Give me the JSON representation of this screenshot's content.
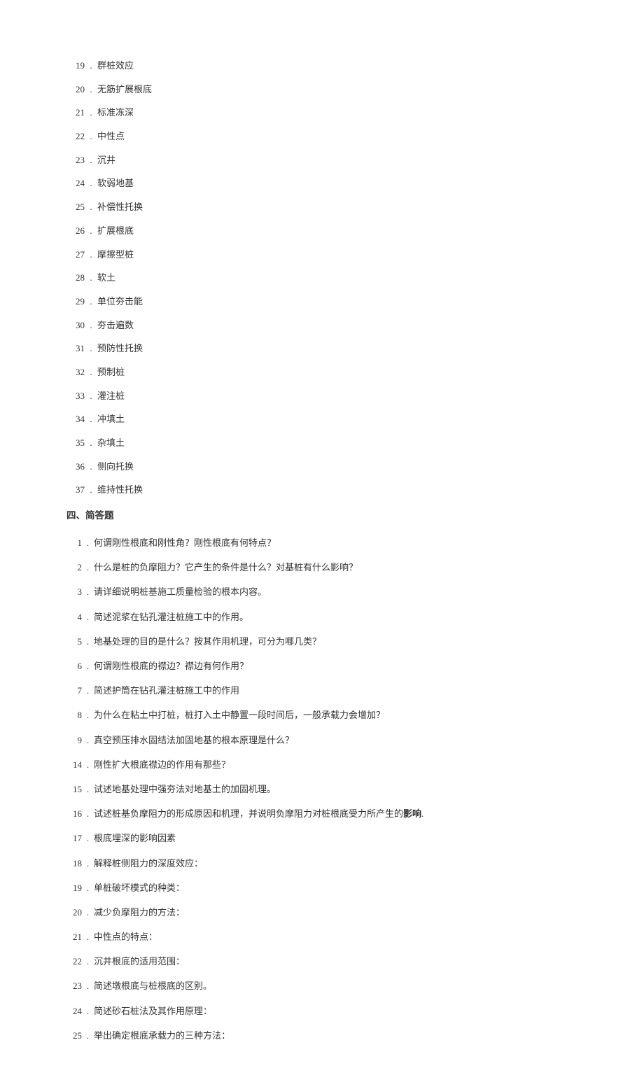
{
  "section_a_items": [
    {
      "num": "19",
      "text": "群桩效应"
    },
    {
      "num": "20",
      "text": "无筋扩展根底"
    },
    {
      "num": "21",
      "text": "标准冻深"
    },
    {
      "num": "22",
      "text": "中性点"
    },
    {
      "num": "23",
      "text": "沉井"
    },
    {
      "num": "24",
      "text": "软弱地基"
    },
    {
      "num": "25",
      "text": "补偿性托换"
    },
    {
      "num": "26",
      "text": "扩展根底"
    },
    {
      "num": "27",
      "text": "摩擦型桩"
    },
    {
      "num": "28",
      "text": "软土"
    },
    {
      "num": "29",
      "text": "单位夯击能"
    },
    {
      "num": "30",
      "text": "夯击遍数"
    },
    {
      "num": "31",
      "text": "预防性托换"
    },
    {
      "num": "32",
      "text": "预制桩"
    },
    {
      "num": "33",
      "text": "灌注桩"
    },
    {
      "num": "34",
      "text": "冲填土"
    },
    {
      "num": "35",
      "text": "杂填土"
    },
    {
      "num": "36",
      "text": "侧向托换"
    },
    {
      "num": "37",
      "text": "维持性托换"
    }
  ],
  "section_b_heading": "四、简答题",
  "section_b_items": [
    {
      "num": "1",
      "text": "何谓刚性根底和刚性角？刚性根底有何特点？"
    },
    {
      "num": "2",
      "text": "什么是桩的负摩阻力？它产生的条件是什么？对基桩有什么影响？"
    },
    {
      "num": "3",
      "text": "请详细说明桩基施工质量检验的根本内容。"
    },
    {
      "num": "4",
      "text": "简述泥浆在钻孔灌注桩施工中的作用。"
    },
    {
      "num": "5",
      "text": "地基处理的目的是什么？按其作用机理，可分为哪几类？"
    },
    {
      "num": "6",
      "text": "何谓刚性根底的襟边？襟边有何作用？"
    },
    {
      "num": "7",
      "text": "简述护筒在钻孔灌注桩施工中的作用"
    },
    {
      "num": "8",
      "text": "为什么在粘土中打桩，桩打入土中静置一段时间后，一般承载力会增加？"
    },
    {
      "num": "9",
      "text": "真空预压排水固结法加固地基的根本原理是什么？"
    },
    {
      "num": "14",
      "text": "刚性扩大根底襟边的作用有那些？"
    },
    {
      "num": "15",
      "text": "试述地基处理中强夯法对地基土的加固机理。"
    },
    {
      "num": "16",
      "text_prefix": "试述桩基负摩阻力的形成原因和机理，并说明负摩阻力对桩根底受力所产生的",
      "text_bold": "影响",
      "text_suffix": "."
    },
    {
      "num": "17",
      "text": "根底埋深的影响因素"
    },
    {
      "num": "18",
      "text": "解释桩侧阻力的深度效应："
    },
    {
      "num": "19",
      "text": "单桩破坏模式的种类："
    },
    {
      "num": "20",
      "text": "减少负摩阻力的方法："
    },
    {
      "num": "21",
      "text": "中性点的特点："
    },
    {
      "num": "22",
      "text": "沉井根底的适用范围："
    },
    {
      "num": "23",
      "text": "简述墩根底与桩根底的区别。"
    },
    {
      "num": "24",
      "text": "简述砂石桩法及其作用原理："
    },
    {
      "num": "25",
      "text": "举出确定根底承载力的三种方法："
    }
  ]
}
